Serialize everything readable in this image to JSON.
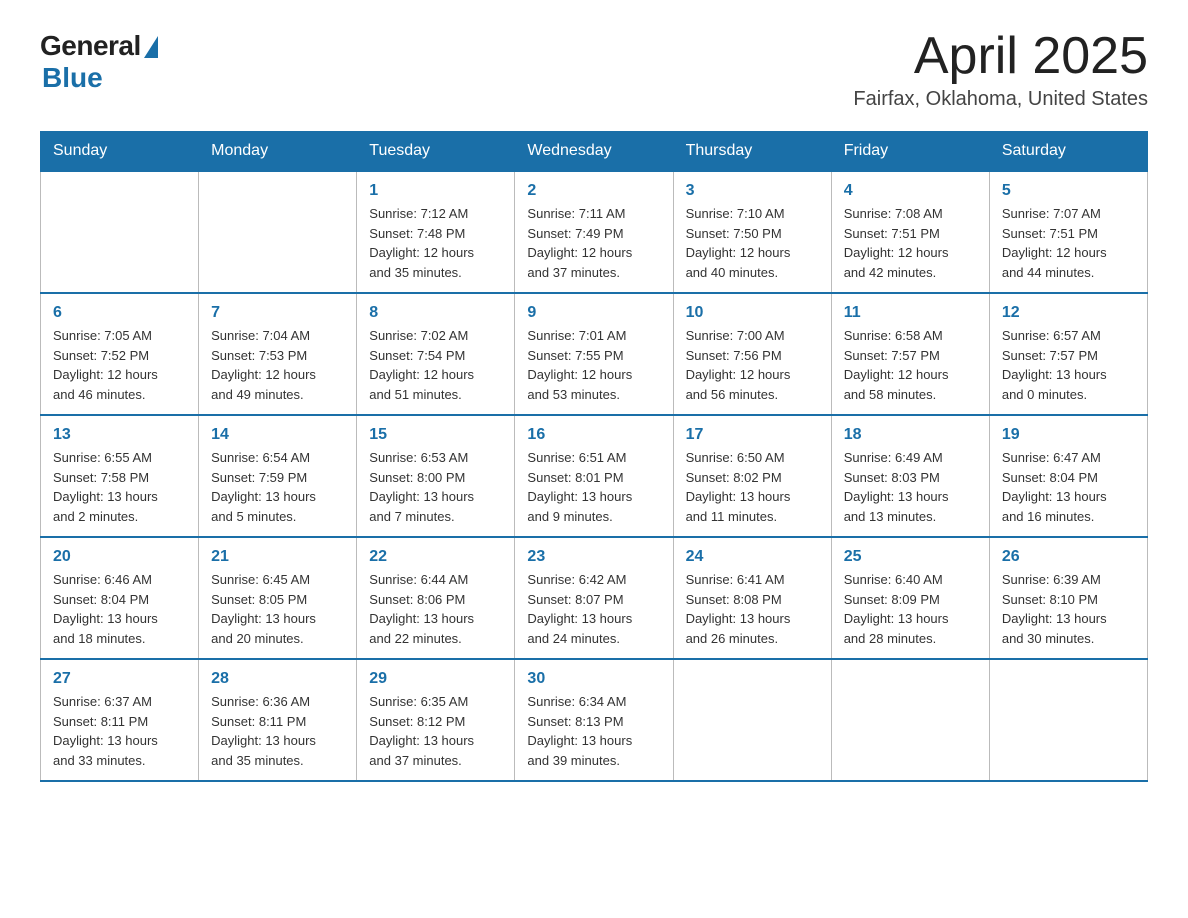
{
  "header": {
    "logo_general": "General",
    "logo_blue": "Blue",
    "title": "April 2025",
    "location": "Fairfax, Oklahoma, United States"
  },
  "days_of_week": [
    "Sunday",
    "Monday",
    "Tuesday",
    "Wednesday",
    "Thursday",
    "Friday",
    "Saturday"
  ],
  "weeks": [
    [
      {
        "day": "",
        "info": ""
      },
      {
        "day": "",
        "info": ""
      },
      {
        "day": "1",
        "info": "Sunrise: 7:12 AM\nSunset: 7:48 PM\nDaylight: 12 hours\nand 35 minutes."
      },
      {
        "day": "2",
        "info": "Sunrise: 7:11 AM\nSunset: 7:49 PM\nDaylight: 12 hours\nand 37 minutes."
      },
      {
        "day": "3",
        "info": "Sunrise: 7:10 AM\nSunset: 7:50 PM\nDaylight: 12 hours\nand 40 minutes."
      },
      {
        "day": "4",
        "info": "Sunrise: 7:08 AM\nSunset: 7:51 PM\nDaylight: 12 hours\nand 42 minutes."
      },
      {
        "day": "5",
        "info": "Sunrise: 7:07 AM\nSunset: 7:51 PM\nDaylight: 12 hours\nand 44 minutes."
      }
    ],
    [
      {
        "day": "6",
        "info": "Sunrise: 7:05 AM\nSunset: 7:52 PM\nDaylight: 12 hours\nand 46 minutes."
      },
      {
        "day": "7",
        "info": "Sunrise: 7:04 AM\nSunset: 7:53 PM\nDaylight: 12 hours\nand 49 minutes."
      },
      {
        "day": "8",
        "info": "Sunrise: 7:02 AM\nSunset: 7:54 PM\nDaylight: 12 hours\nand 51 minutes."
      },
      {
        "day": "9",
        "info": "Sunrise: 7:01 AM\nSunset: 7:55 PM\nDaylight: 12 hours\nand 53 minutes."
      },
      {
        "day": "10",
        "info": "Sunrise: 7:00 AM\nSunset: 7:56 PM\nDaylight: 12 hours\nand 56 minutes."
      },
      {
        "day": "11",
        "info": "Sunrise: 6:58 AM\nSunset: 7:57 PM\nDaylight: 12 hours\nand 58 minutes."
      },
      {
        "day": "12",
        "info": "Sunrise: 6:57 AM\nSunset: 7:57 PM\nDaylight: 13 hours\nand 0 minutes."
      }
    ],
    [
      {
        "day": "13",
        "info": "Sunrise: 6:55 AM\nSunset: 7:58 PM\nDaylight: 13 hours\nand 2 minutes."
      },
      {
        "day": "14",
        "info": "Sunrise: 6:54 AM\nSunset: 7:59 PM\nDaylight: 13 hours\nand 5 minutes."
      },
      {
        "day": "15",
        "info": "Sunrise: 6:53 AM\nSunset: 8:00 PM\nDaylight: 13 hours\nand 7 minutes."
      },
      {
        "day": "16",
        "info": "Sunrise: 6:51 AM\nSunset: 8:01 PM\nDaylight: 13 hours\nand 9 minutes."
      },
      {
        "day": "17",
        "info": "Sunrise: 6:50 AM\nSunset: 8:02 PM\nDaylight: 13 hours\nand 11 minutes."
      },
      {
        "day": "18",
        "info": "Sunrise: 6:49 AM\nSunset: 8:03 PM\nDaylight: 13 hours\nand 13 minutes."
      },
      {
        "day": "19",
        "info": "Sunrise: 6:47 AM\nSunset: 8:04 PM\nDaylight: 13 hours\nand 16 minutes."
      }
    ],
    [
      {
        "day": "20",
        "info": "Sunrise: 6:46 AM\nSunset: 8:04 PM\nDaylight: 13 hours\nand 18 minutes."
      },
      {
        "day": "21",
        "info": "Sunrise: 6:45 AM\nSunset: 8:05 PM\nDaylight: 13 hours\nand 20 minutes."
      },
      {
        "day": "22",
        "info": "Sunrise: 6:44 AM\nSunset: 8:06 PM\nDaylight: 13 hours\nand 22 minutes."
      },
      {
        "day": "23",
        "info": "Sunrise: 6:42 AM\nSunset: 8:07 PM\nDaylight: 13 hours\nand 24 minutes."
      },
      {
        "day": "24",
        "info": "Sunrise: 6:41 AM\nSunset: 8:08 PM\nDaylight: 13 hours\nand 26 minutes."
      },
      {
        "day": "25",
        "info": "Sunrise: 6:40 AM\nSunset: 8:09 PM\nDaylight: 13 hours\nand 28 minutes."
      },
      {
        "day": "26",
        "info": "Sunrise: 6:39 AM\nSunset: 8:10 PM\nDaylight: 13 hours\nand 30 minutes."
      }
    ],
    [
      {
        "day": "27",
        "info": "Sunrise: 6:37 AM\nSunset: 8:11 PM\nDaylight: 13 hours\nand 33 minutes."
      },
      {
        "day": "28",
        "info": "Sunrise: 6:36 AM\nSunset: 8:11 PM\nDaylight: 13 hours\nand 35 minutes."
      },
      {
        "day": "29",
        "info": "Sunrise: 6:35 AM\nSunset: 8:12 PM\nDaylight: 13 hours\nand 37 minutes."
      },
      {
        "day": "30",
        "info": "Sunrise: 6:34 AM\nSunset: 8:13 PM\nDaylight: 13 hours\nand 39 minutes."
      },
      {
        "day": "",
        "info": ""
      },
      {
        "day": "",
        "info": ""
      },
      {
        "day": "",
        "info": ""
      }
    ]
  ]
}
